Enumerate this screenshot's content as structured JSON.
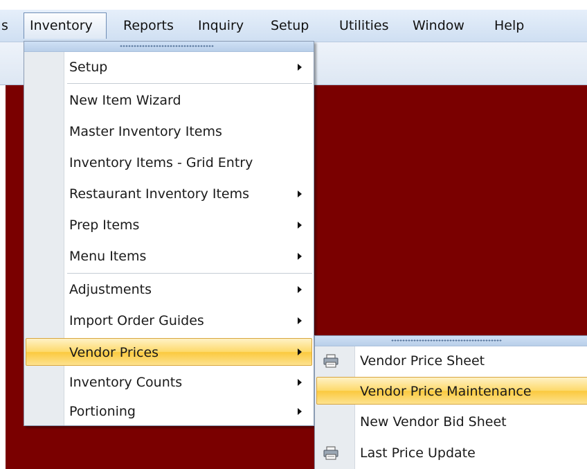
{
  "menubar": {
    "items": [
      {
        "label": "s"
      },
      {
        "label": "Inventory"
      },
      {
        "label": "Reports"
      },
      {
        "label": "Inquiry"
      },
      {
        "label": "Setup"
      },
      {
        "label": "Utilities"
      },
      {
        "label": "Window"
      },
      {
        "label": "Help"
      }
    ]
  },
  "inventory_menu": {
    "items": [
      {
        "label": "Setup",
        "submenu": true
      },
      {
        "label": "New Item Wizard",
        "submenu": false
      },
      {
        "label": "Master Inventory Items",
        "submenu": false
      },
      {
        "label": "Inventory Items - Grid Entry",
        "submenu": false
      },
      {
        "label": "Restaurant Inventory Items",
        "submenu": true
      },
      {
        "label": "Prep Items",
        "submenu": true
      },
      {
        "label": "Menu Items",
        "submenu": true
      },
      {
        "label": "Adjustments",
        "submenu": true
      },
      {
        "label": "Import Order Guides",
        "submenu": true
      },
      {
        "label": "Vendor Prices",
        "submenu": true,
        "highlighted": true
      },
      {
        "label": "Inventory Counts",
        "submenu": true
      },
      {
        "label": "Portioning",
        "submenu": true
      }
    ]
  },
  "vendor_prices_submenu": {
    "items": [
      {
        "label": "Vendor Price Sheet",
        "icon": "printer-icon"
      },
      {
        "label": "Vendor Price Maintenance",
        "highlighted": true
      },
      {
        "label": "New Vendor Bid Sheet"
      },
      {
        "label": "Last Price Update",
        "icon": "printer-icon"
      }
    ]
  },
  "colors": {
    "desktop_background": "#7a0000",
    "highlight": "#fbc93e",
    "menubar": "#cfdff2"
  }
}
